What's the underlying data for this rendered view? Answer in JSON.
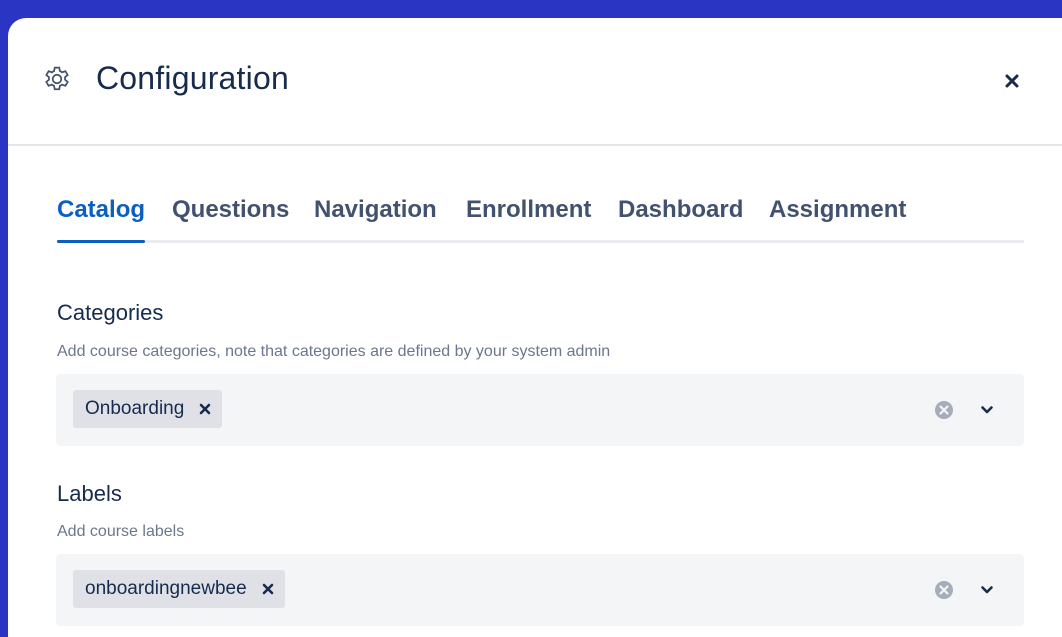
{
  "modal": {
    "title": "Configuration",
    "header_icon": "gear-icon",
    "close_icon": "close-icon"
  },
  "tabs": [
    {
      "label": "Catalog",
      "active": true
    },
    {
      "label": "Questions",
      "active": false
    },
    {
      "label": "Navigation",
      "active": false
    },
    {
      "label": "Enrollment",
      "active": false
    },
    {
      "label": "Dashboard",
      "active": false
    },
    {
      "label": "Assignment",
      "active": false
    }
  ],
  "categories": {
    "label": "Categories",
    "help": "Add course categories, note that categories are defined by your system admin",
    "selected": [
      "Onboarding"
    ]
  },
  "labels": {
    "label": "Labels",
    "help": "Add course labels",
    "selected": [
      "onboardingnewbee"
    ]
  },
  "colors": {
    "background": "#2b35c4",
    "accent": "#0c5fbf",
    "text": "#172b4d",
    "muted": "#6b778c"
  }
}
